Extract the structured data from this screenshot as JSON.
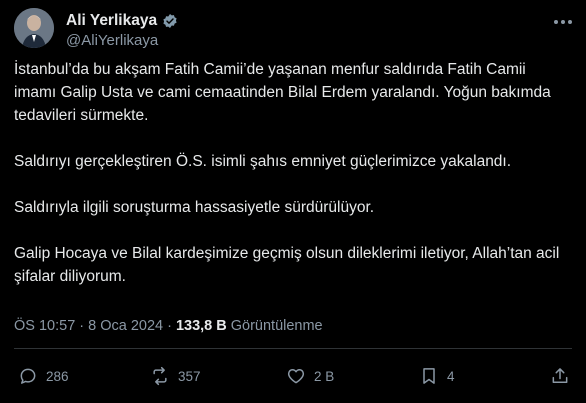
{
  "author": {
    "display_name": "Ali Yerlikaya",
    "handle": "@AliYerlikaya"
  },
  "post": {
    "paragraphs": [
      "İstanbul’da bu akşam Fatih Camii’de yaşanan menfur saldırıda Fatih Camii imamı Galip Usta ve cami cemaatinden Bilal Erdem yaralandı. Yoğun bakımda tedavileri sürmekte.",
      "Saldırıyı gerçekleştiren Ö.S. isimli şahıs emniyet güçlerimizce yakalandı.",
      "Saldırıyla ilgili soruşturma hassasiyetle sürdürülüyor.",
      "Galip Hocaya ve Bilal kardeşimize geçmiş olsun dileklerimi iletiyor, Allah’tan acil şifalar diliyorum."
    ]
  },
  "meta": {
    "time": "ÖS 10:57",
    "separator": "·",
    "date": "8 Oca 2024",
    "views": "133,8 B",
    "views_label": "Görüntülenme"
  },
  "actions": {
    "replies": "286",
    "reposts": "357",
    "likes": "2 B",
    "bookmarks": "4"
  },
  "colors": {
    "background": "#000000",
    "text": "#e7e9ea",
    "muted": "#8b98a5",
    "verified": "#829aab"
  },
  "icons": [
    "verified-badge-icon",
    "more-icon",
    "reply-icon",
    "repost-icon",
    "like-icon",
    "bookmark-icon",
    "share-icon"
  ]
}
